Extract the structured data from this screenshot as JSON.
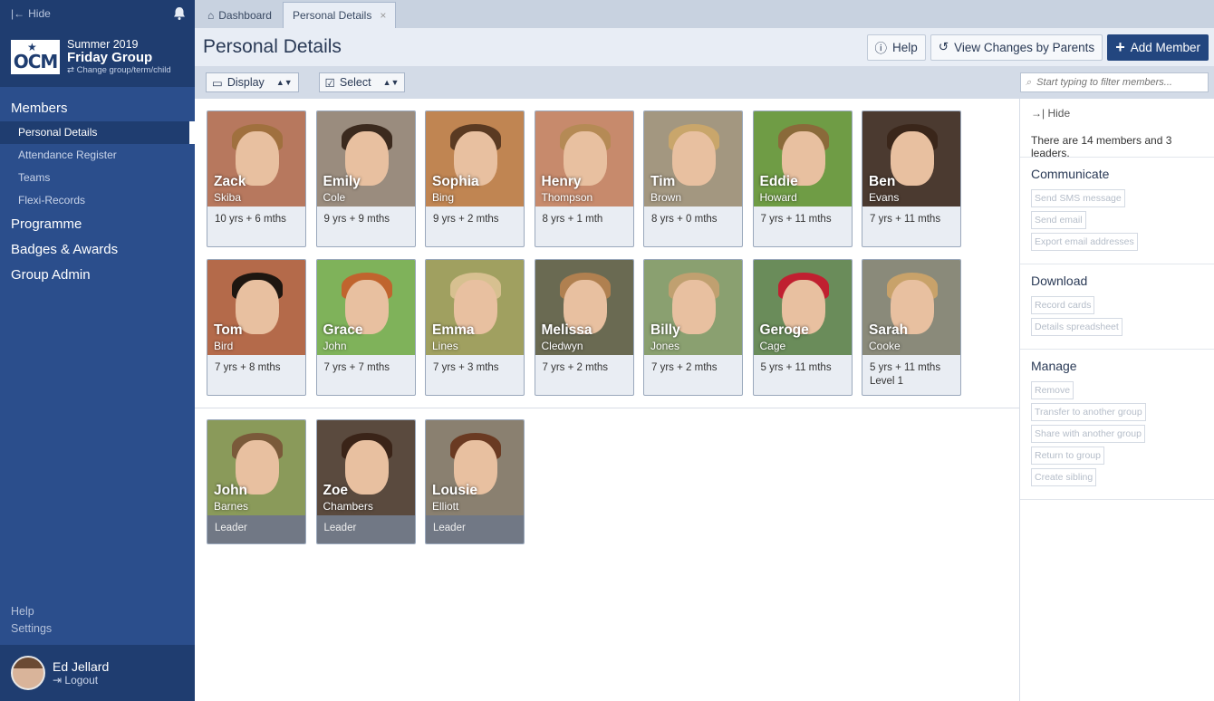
{
  "sidebar": {
    "hide_label": "Hide",
    "term": "Summer 2019",
    "group": "Friday Group",
    "change": "Change group/term/child",
    "logo": "OCM",
    "sections": [
      {
        "label": "Members",
        "items": [
          {
            "label": "Personal Details",
            "active": true
          },
          {
            "label": "Attendance Register"
          },
          {
            "label": "Teams"
          },
          {
            "label": "Flexi-Records"
          }
        ]
      },
      {
        "label": "Programme",
        "items": []
      },
      {
        "label": "Badges & Awards",
        "items": []
      },
      {
        "label": "Group Admin",
        "items": []
      }
    ],
    "help": "Help",
    "settings": "Settings",
    "user": {
      "name": "Ed Jellard",
      "logout": "Logout"
    }
  },
  "tabs": [
    {
      "label": "Dashboard",
      "icon": "home-icon"
    },
    {
      "label": "Personal Details",
      "active": true
    }
  ],
  "header": {
    "title": "Personal Details",
    "help_label": "Help",
    "changes_label": "View Changes by Parents",
    "add_label": "Add Member"
  },
  "toolbar": {
    "display_label": "Display",
    "select_label": "Select",
    "search_placeholder": "Start typing to filter members..."
  },
  "members": [
    {
      "first": "Zack",
      "last": "Skiba",
      "age": "10 yrs + 6 mths",
      "bg": "#b7785e",
      "hair": "#a0703e"
    },
    {
      "first": "Emily",
      "last": "Cole",
      "age": "9 yrs + 9 mths",
      "bg": "#9a8c7e",
      "hair": "#3b2a1e"
    },
    {
      "first": "Sophia",
      "last": "Bing",
      "age": "9 yrs + 2 mths",
      "bg": "#c08552",
      "hair": "#5a3a22"
    },
    {
      "first": "Henry",
      "last": "Thompson",
      "age": "8 yrs + 1 mth",
      "bg": "#c78a6c",
      "hair": "#b58a55"
    },
    {
      "first": "Tim",
      "last": "Brown",
      "age": "8 yrs + 0 mths",
      "bg": "#a39780",
      "hair": "#c9a66b"
    },
    {
      "first": "Eddie",
      "last": "Howard",
      "age": "7 yrs + 11 mths",
      "bg": "#6f9c45",
      "hair": "#8a6a3a"
    },
    {
      "first": "Ben",
      "last": "Evans",
      "age": "7 yrs + 11 mths",
      "bg": "#4b3a30",
      "hair": "#3a261a"
    },
    {
      "first": "Tom",
      "last": "Bird",
      "age": "7 yrs + 8 mths",
      "bg": "#b46a4a",
      "hair": "#1e1610"
    },
    {
      "first": "Grace",
      "last": "John",
      "age": "7 yrs + 7 mths",
      "bg": "#7fb25a",
      "hair": "#c0642e"
    },
    {
      "first": "Emma",
      "last": "Lines",
      "age": "7 yrs + 3 mths",
      "bg": "#a0a060",
      "hair": "#d7c090"
    },
    {
      "first": "Melissa",
      "last": "Cledwyn",
      "age": "7 yrs + 2 mths",
      "bg": "#6a6a52",
      "hair": "#b08050"
    },
    {
      "first": "Billy",
      "last": "Jones",
      "age": "7 yrs + 2 mths",
      "bg": "#8aa070",
      "hair": "#c0a070"
    },
    {
      "first": "Geroge",
      "last": "Cage",
      "age": "5 yrs + 11 mths",
      "bg": "#6a8c5a",
      "hair": "#c02030"
    },
    {
      "first": "Sarah",
      "last": "Cooke",
      "age": "5 yrs + 11 mths",
      "extra": "Level 1",
      "bg": "#8a8a7a",
      "hair": "#c8a26a"
    }
  ],
  "leaders": [
    {
      "first": "John",
      "last": "Barnes",
      "role": "Leader",
      "bg": "#8a9a5a",
      "hair": "#7a5a3a"
    },
    {
      "first": "Zoe",
      "last": "Chambers",
      "role": "Leader",
      "bg": "#5a4a3e",
      "hair": "#3a2418"
    },
    {
      "first": "Lousie",
      "last": "Elliott",
      "role": "Leader",
      "bg": "#8a8070",
      "hair": "#6a3a22"
    }
  ],
  "panel": {
    "hide_label": "Hide",
    "info": "There are 14 members and 3 leaders.",
    "sections": [
      {
        "title": "Communicate",
        "buttons": [
          "Send SMS message",
          "Send email",
          "Export email addresses"
        ]
      },
      {
        "title": "Download",
        "buttons": [
          "Record cards",
          "Details spreadsheet"
        ]
      },
      {
        "title": "Manage",
        "buttons": [
          "Remove",
          "Transfer to another group",
          "Share with another group",
          "Return to group",
          "Create sibling"
        ]
      }
    ]
  },
  "colors": {
    "sidebar": "#2b4e8c",
    "sidebar_dark": "#1f3d70",
    "primary": "#23467f"
  }
}
